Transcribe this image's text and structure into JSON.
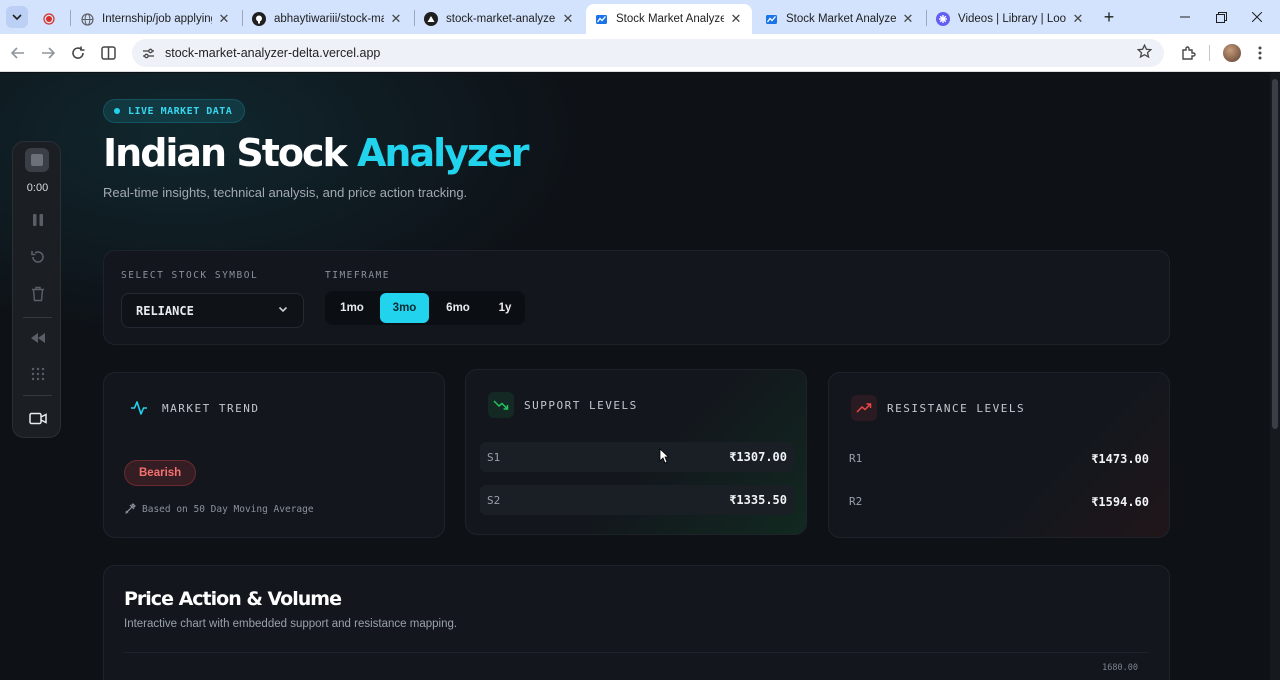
{
  "browser": {
    "tabs": [
      {
        "title": "",
        "favicon": "recording-dot-icon",
        "active": false
      },
      {
        "title": "Internship/job applying a",
        "favicon": "globe-icon",
        "active": false
      },
      {
        "title": "abhaytiwariii/stock-mark",
        "favicon": "github-icon",
        "active": false
      },
      {
        "title": "stock-market-analyzer – ⁣",
        "favicon": "vercel-icon",
        "active": false
      },
      {
        "title": "Stock Market Analyzer | F",
        "favicon": "chart-icon",
        "active": true
      },
      {
        "title": "Stock Market Analyzer | F",
        "favicon": "chart-icon",
        "active": false
      },
      {
        "title": "Videos | Library | Loom",
        "favicon": "loom-icon",
        "active": false
      }
    ],
    "url": "stock-market-analyzer-delta.vercel.app"
  },
  "loom": {
    "time": "0:00"
  },
  "hero": {
    "badge": "LIVE MARKET DATA",
    "title_main": "Indian Stock ",
    "title_accent": "Analyzer",
    "subtitle": "Real-time insights, technical analysis, and price action tracking."
  },
  "controls": {
    "symbol_label": "SELECT STOCK SYMBOL",
    "symbol_value": "RELIANCE",
    "timeframe_label": "TIMEFRAME",
    "timeframes": [
      "1mo",
      "3mo",
      "6mo",
      "1y"
    ],
    "selected_timeframe": "3mo"
  },
  "trend": {
    "title": "MARKET TREND",
    "badge": "Bearish",
    "note": "Based on 50 Day Moving Average"
  },
  "support": {
    "title": "SUPPORT LEVELS",
    "levels": [
      {
        "key": "S1",
        "value": "₹1307.00"
      },
      {
        "key": "S2",
        "value": "₹1335.50"
      }
    ]
  },
  "resistance": {
    "title": "RESISTANCE LEVELS",
    "levels": [
      {
        "key": "R1",
        "value": "₹1473.00"
      },
      {
        "key": "R2",
        "value": "₹1594.60"
      }
    ]
  },
  "price_action": {
    "title": "Price Action & Volume",
    "subtitle": "Interactive chart with embedded support and resistance mapping.",
    "top_tick": "1680.00"
  },
  "colors": {
    "accent": "#22d3ee",
    "bearish": "#f87171",
    "support_icon": "#22c55e",
    "resistance_icon": "#ef4444"
  }
}
